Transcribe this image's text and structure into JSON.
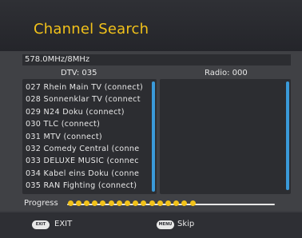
{
  "header": {
    "title": "Channel Search"
  },
  "frequency": "578.0MHz/8MHz",
  "columns": {
    "dtv": "DTV: 035",
    "radio": "Radio: 000"
  },
  "tv_channels": [
    "027 Rhein Main TV (connect)",
    "028 Sonnenklar TV (connect",
    "029 N24 Doku (connect)",
    "030 TLC (connect)",
    "031 MTV (connect)",
    "032 Comedy Central (conne",
    "033 DELUXE MUSIC (connec",
    "034 Kabel eins Doku (conne",
    "035 RAN Fighting (connect)"
  ],
  "radio_channels": [],
  "progress": {
    "label": "Progress",
    "value_fraction": 0.62
  },
  "footer": {
    "exit_key": "EXIT",
    "exit_label": "EXIT",
    "menu_key": "MENU",
    "skip_label": "Skip"
  },
  "colors": {
    "accent": "#f2c21a",
    "scroll": "#3a9ad9"
  },
  "icons": {
    "exit": "exit-key-icon",
    "menu": "menu-key-icon"
  }
}
